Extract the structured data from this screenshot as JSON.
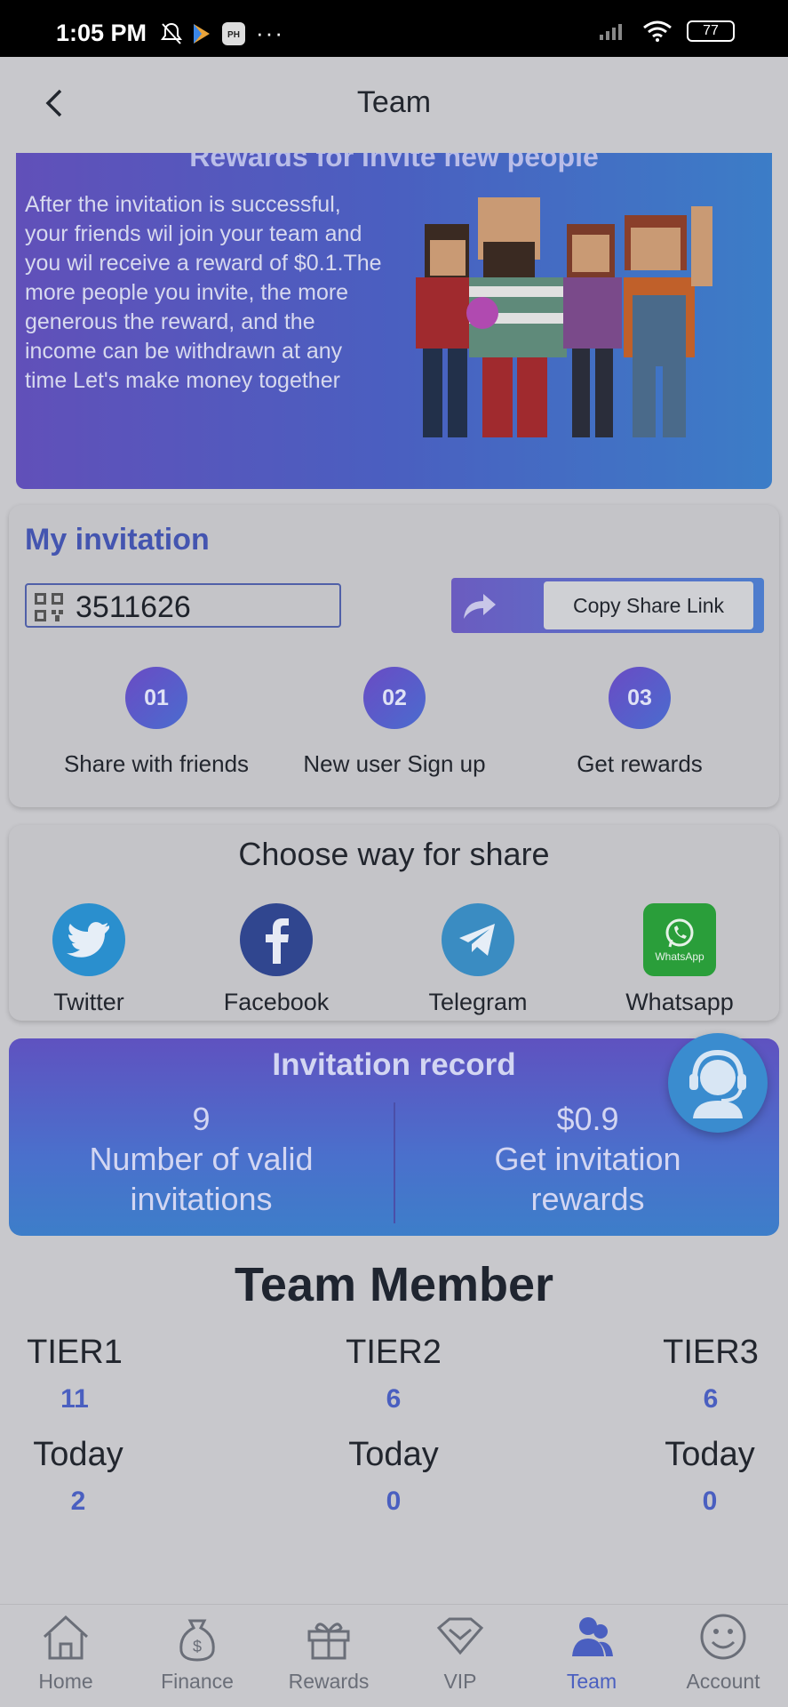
{
  "status_bar": {
    "time": "1:05 PM",
    "battery": "77"
  },
  "header": {
    "title": "Team"
  },
  "banner": {
    "heading": "Rewards for invite new people",
    "description": "After the invitation is successful, your friends wil join your team and you wil receive a reward of $0.1.The more people you invite, the more generous the reward, and the income can be withdrawn at any time Let's make money together"
  },
  "invitation": {
    "title": "My invitation",
    "code": "3511626",
    "copy_label": "Copy Share Link",
    "steps": [
      {
        "num": "01",
        "label": "Share with friends"
      },
      {
        "num": "02",
        "label": "New user Sign up"
      },
      {
        "num": "03",
        "label": "Get rewards"
      }
    ]
  },
  "share": {
    "title": "Choose way for share",
    "items": [
      {
        "label": "Twitter",
        "icon": "twitter-icon"
      },
      {
        "label": "Facebook",
        "icon": "facebook-icon"
      },
      {
        "label": "Telegram",
        "icon": "telegram-icon"
      },
      {
        "label": "Whatsapp",
        "icon": "whatsapp-icon",
        "badge": "WhatsApp"
      }
    ]
  },
  "record": {
    "title": "Invitation record",
    "valid_count": "9",
    "valid_label_1": "Number of valid",
    "valid_label_2": "invitations",
    "reward_value": "$0.9",
    "reward_label_1": "Get invitation",
    "reward_label_2": "rewards"
  },
  "members": {
    "title": "Team Member",
    "tiers": [
      {
        "label": "TIER1",
        "value": "11",
        "today_label": "Today",
        "today_value": "2"
      },
      {
        "label": "TIER2",
        "value": "6",
        "today_label": "Today",
        "today_value": "0"
      },
      {
        "label": "TIER3",
        "value": "6",
        "today_label": "Today",
        "today_value": "0"
      }
    ]
  },
  "tabs": [
    {
      "label": "Home",
      "icon": "home-icon"
    },
    {
      "label": "Finance",
      "icon": "money-bag-icon"
    },
    {
      "label": "Rewards",
      "icon": "gift-icon"
    },
    {
      "label": "VIP",
      "icon": "diamond-icon"
    },
    {
      "label": "Team",
      "icon": "team-icon",
      "active": true
    },
    {
      "label": "Account",
      "icon": "smiley-icon"
    }
  ],
  "colors": {
    "accent": "#4a5fc0",
    "banner_start": "#6150b9",
    "banner_end": "#3c7dc7",
    "twitter": "#2a8fce",
    "facebook": "#30468f",
    "telegram": "#3a8cc2",
    "whatsapp": "#2a9e3a"
  }
}
